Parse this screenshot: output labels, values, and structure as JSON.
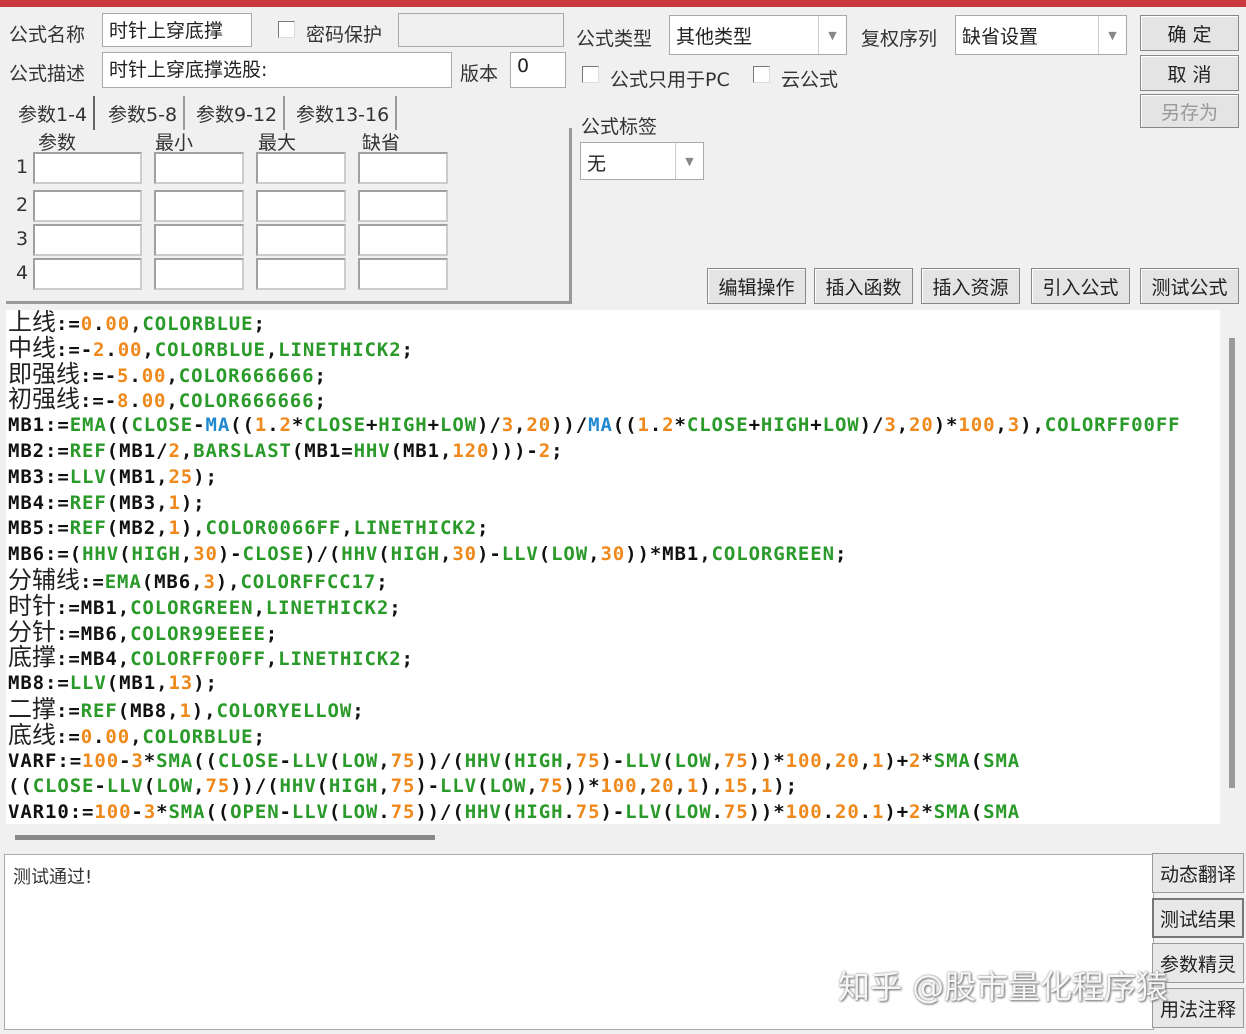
{
  "header": {
    "name_label": "公式名称",
    "name_value": "时针上穿底撑",
    "password_label": "密码保护",
    "password_value": "",
    "desc_label": "公式描述",
    "desc_value": "时针上穿底撑选股:",
    "version_label": "版本",
    "version_value": "0",
    "type_label": "公式类型",
    "type_value": "其他类型",
    "adjust_label": "复权序列",
    "adjust_value": "缺省设置",
    "pc_only_label": "公式只用于PC",
    "cloud_label": "云公式",
    "tag_label": "公式标签",
    "tag_value": "无"
  },
  "buttons": {
    "ok": "确 定",
    "cancel": "取 消",
    "save_as": "另存为"
  },
  "tabs": [
    "参数1-4",
    "参数5-8",
    "参数9-12",
    "参数13-16"
  ],
  "params": {
    "columns": [
      "参数",
      "最小",
      "最大",
      "缺省"
    ],
    "rows": [
      "1",
      "2",
      "3",
      "4"
    ]
  },
  "toolbar": [
    "编辑操作",
    "插入函数",
    "插入资源",
    "引入公式",
    "测试公式"
  ],
  "code_lines": [
    "上线:=0.00,COLORBLUE;",
    "中线:=-2.00,COLORBLUE,LINETHICK2;",
    "即强线:=-5.00,COLOR666666;",
    "初强线:=-8.00,COLOR666666;",
    "MB1:=EMA((CLOSE-MA((1.2*CLOSE+HIGH+LOW)/3,20))/MA((1.2*CLOSE+HIGH+LOW)/3,20)*100,3),COLORFF00FF",
    "MB2:=REF(MB1/2,BARSLAST(MB1=HHV(MB1,120)))-2;",
    "MB3:=LLV(MB1,25);",
    "MB4:=REF(MB3,1);",
    "MB5:=REF(MB2,1),COLOR0066FF,LINETHICK2;",
    "MB6:=(HHV(HIGH,30)-CLOSE)/(HHV(HIGH,30)-LLV(LOW,30))*MB1,COLORGREEN;",
    "分辅线:=EMA(MB6,3),COLORFFCC17;",
    "时针:=MB1,COLORGREEN,LINETHICK2;",
    "分针:=MB6,COLOR99EEEE;",
    "底撑:=MB4,COLORFF00FF,LINETHICK2;",
    "MB8:=LLV(MB1,13);",
    "二撑:=REF(MB8,1),COLORYELLOW;",
    "底线:=0.00,COLORBLUE;",
    "VARF:=100-3*SMA((CLOSE-LLV(LOW,75))/(HHV(HIGH,75)-LLV(LOW,75))*100,20,1)+2*SMA(SMA",
    "((CLOSE-LLV(LOW,75))/(HHV(HIGH,75)-LLV(LOW,75))*100,20,1),15,1);",
    "VAR10:=100-3*SMA((OPEN-LLV(LOW.75))/(HHV(HIGH.75)-LLV(LOW.75))*100.20.1)+2*SMA(SMA"
  ],
  "output": {
    "text": "测试通过!"
  },
  "side_buttons": [
    "动态翻译",
    "测试结果",
    "参数精灵",
    "用法注释"
  ],
  "watermark": "知乎 @股市量化程序猿",
  "colors": {
    "function": "#2a9a2a",
    "number": "#f0891c",
    "ma": "#1f88cf",
    "title_bar": "#c9383f"
  }
}
